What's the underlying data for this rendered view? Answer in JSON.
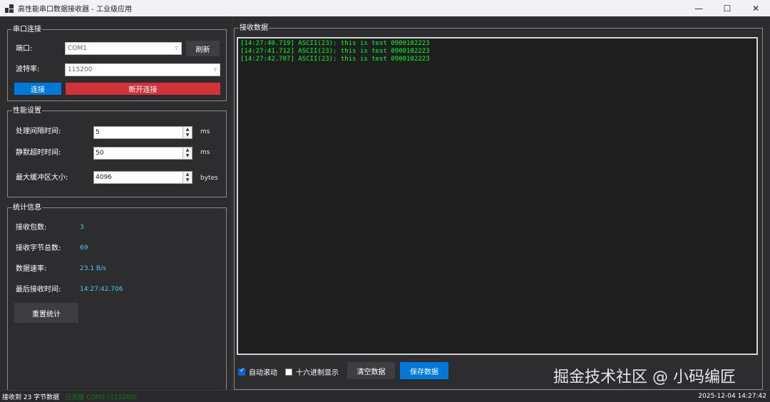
{
  "window": {
    "title": "高性能串口数据接收器 - 工业级应用",
    "minimize_icon": "minimize-icon",
    "maximize_icon": "maximize-icon",
    "close_icon": "close-icon"
  },
  "serial": {
    "group_title": "串口连接",
    "port_label": "端口:",
    "port_value": "COM1",
    "refresh_label": "刷新",
    "baud_label": "波特率:",
    "baud_value": "115200",
    "connect_label": "连接",
    "disconnect_label": "断开连接"
  },
  "performance": {
    "group_title": "性能设置",
    "interval_label": "处理间隔时间:",
    "interval_value": "5",
    "interval_unit": "ms",
    "silence_label": "静默超时时间:",
    "silence_value": "50",
    "silence_unit": "ms",
    "buffer_label": "最大缓冲区大小:",
    "buffer_value": "4096",
    "buffer_unit": "bytes"
  },
  "stats": {
    "group_title": "统计信息",
    "packets_label": "接收包数:",
    "packets_value": "3",
    "bytes_label": "接收字节总数:",
    "bytes_value": "69",
    "rate_label": "数据速率:",
    "rate_value": "23.1 B/s",
    "last_label": "最后接收时间:",
    "last_value": "14:27:42.706",
    "reset_label": "重置统计"
  },
  "receive": {
    "group_title": "接收数据",
    "lines": [
      "[14:27:40.719] ASCII(23): this is test 0900102223",
      "[14:27:41.712] ASCII(23): this is test 0900102223",
      "[14:27:42.707] ASCII(23): this is test 0900102223"
    ],
    "auto_scroll_label": "自动滚动",
    "auto_scroll_checked": true,
    "hex_label": "十六进制显示",
    "hex_checked": false,
    "clear_label": "清空数据",
    "save_label": "保存数据"
  },
  "status": {
    "left_text": "接收到 23 字节数据",
    "ghost_text": "已连接 COM1 (115200)",
    "datetime": "2025-12-04 14:27:42"
  },
  "watermark": {
    "text": "掘金技术社区 @ 小码编匠"
  },
  "colors": {
    "background": "#2d2d30",
    "log_text": "#00ff2a",
    "stat_value": "#4ec9e0",
    "connect_button": "#0078d7",
    "disconnect_button": "#d13438",
    "save_button": "#0078d7"
  }
}
